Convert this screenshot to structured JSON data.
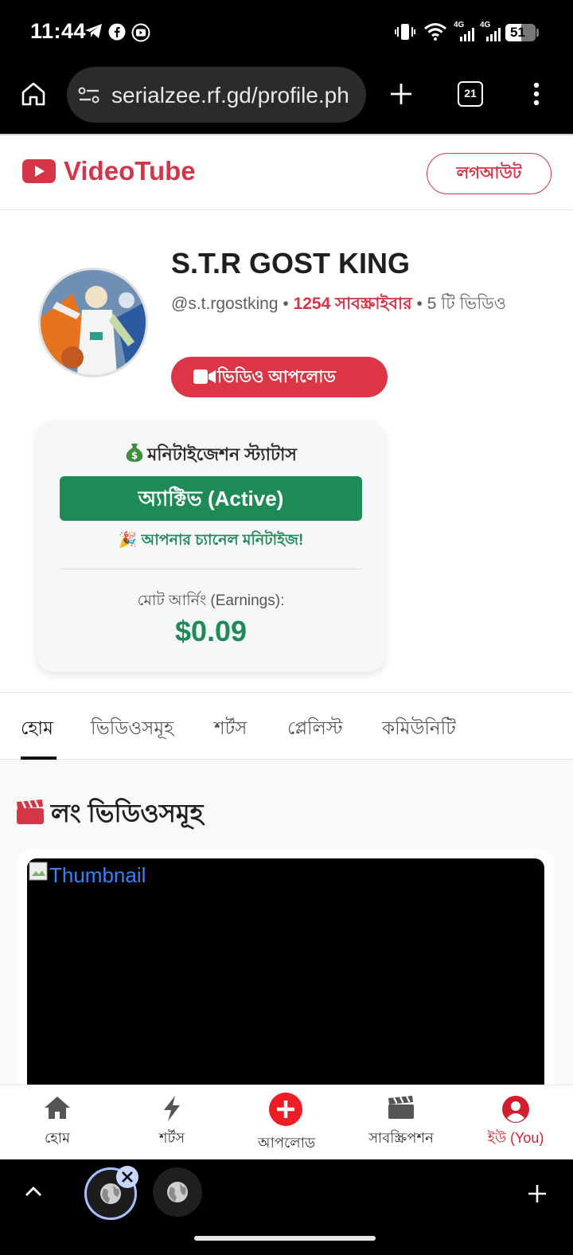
{
  "status_bar": {
    "time": "11:44",
    "battery": "51",
    "network_1": "4G",
    "network_2": "4G"
  },
  "browser": {
    "url": "serialzee.rf.gd/profile.ph",
    "tab_count": "21"
  },
  "site": {
    "brand": "VideoTube",
    "logout_label": "লগআউট",
    "brand_color": "#d63447"
  },
  "channel": {
    "name": "S.T.R GOST KING",
    "handle": "@s.t.rgostking",
    "sep1": " • ",
    "subscribers": "1254 সাবস্ক্রাইবার",
    "sep2": " • ",
    "videos": "5 টি ভিডিও",
    "upload_label": "ভিডিও আপলোড"
  },
  "monetization": {
    "title": "মনিটাইজেশন স্ট্যাটাস",
    "status": "অ্যাক্টিভ (Active)",
    "message": "🎉 আপনার চ্যানেল মনিটাইজ!",
    "earnings_label": "মোট আর্নিং (Earnings):",
    "earnings_value": "$0.09",
    "status_color": "#1e8a55"
  },
  "tabs": [
    {
      "label": "হোম",
      "active": true
    },
    {
      "label": "ভিডিওসমূহ"
    },
    {
      "label": "শর্টস"
    },
    {
      "label": "প্লেলিস্ট"
    },
    {
      "label": "কমিউনিটি"
    }
  ],
  "section": {
    "title": "লং ভিডিওসমূহ",
    "thumbnail_alt": "Thumbnail"
  },
  "bottom_nav": [
    {
      "label": "হোম",
      "icon": "home-icon"
    },
    {
      "label": "শর্টস",
      "icon": "bolt-icon"
    },
    {
      "label": "আপলোড",
      "icon": "plus-circle-icon"
    },
    {
      "label": "সাবস্ক্রিপশন",
      "icon": "clapperboard-icon"
    },
    {
      "label": "ইউ (You)",
      "icon": "user-circle-icon"
    }
  ]
}
